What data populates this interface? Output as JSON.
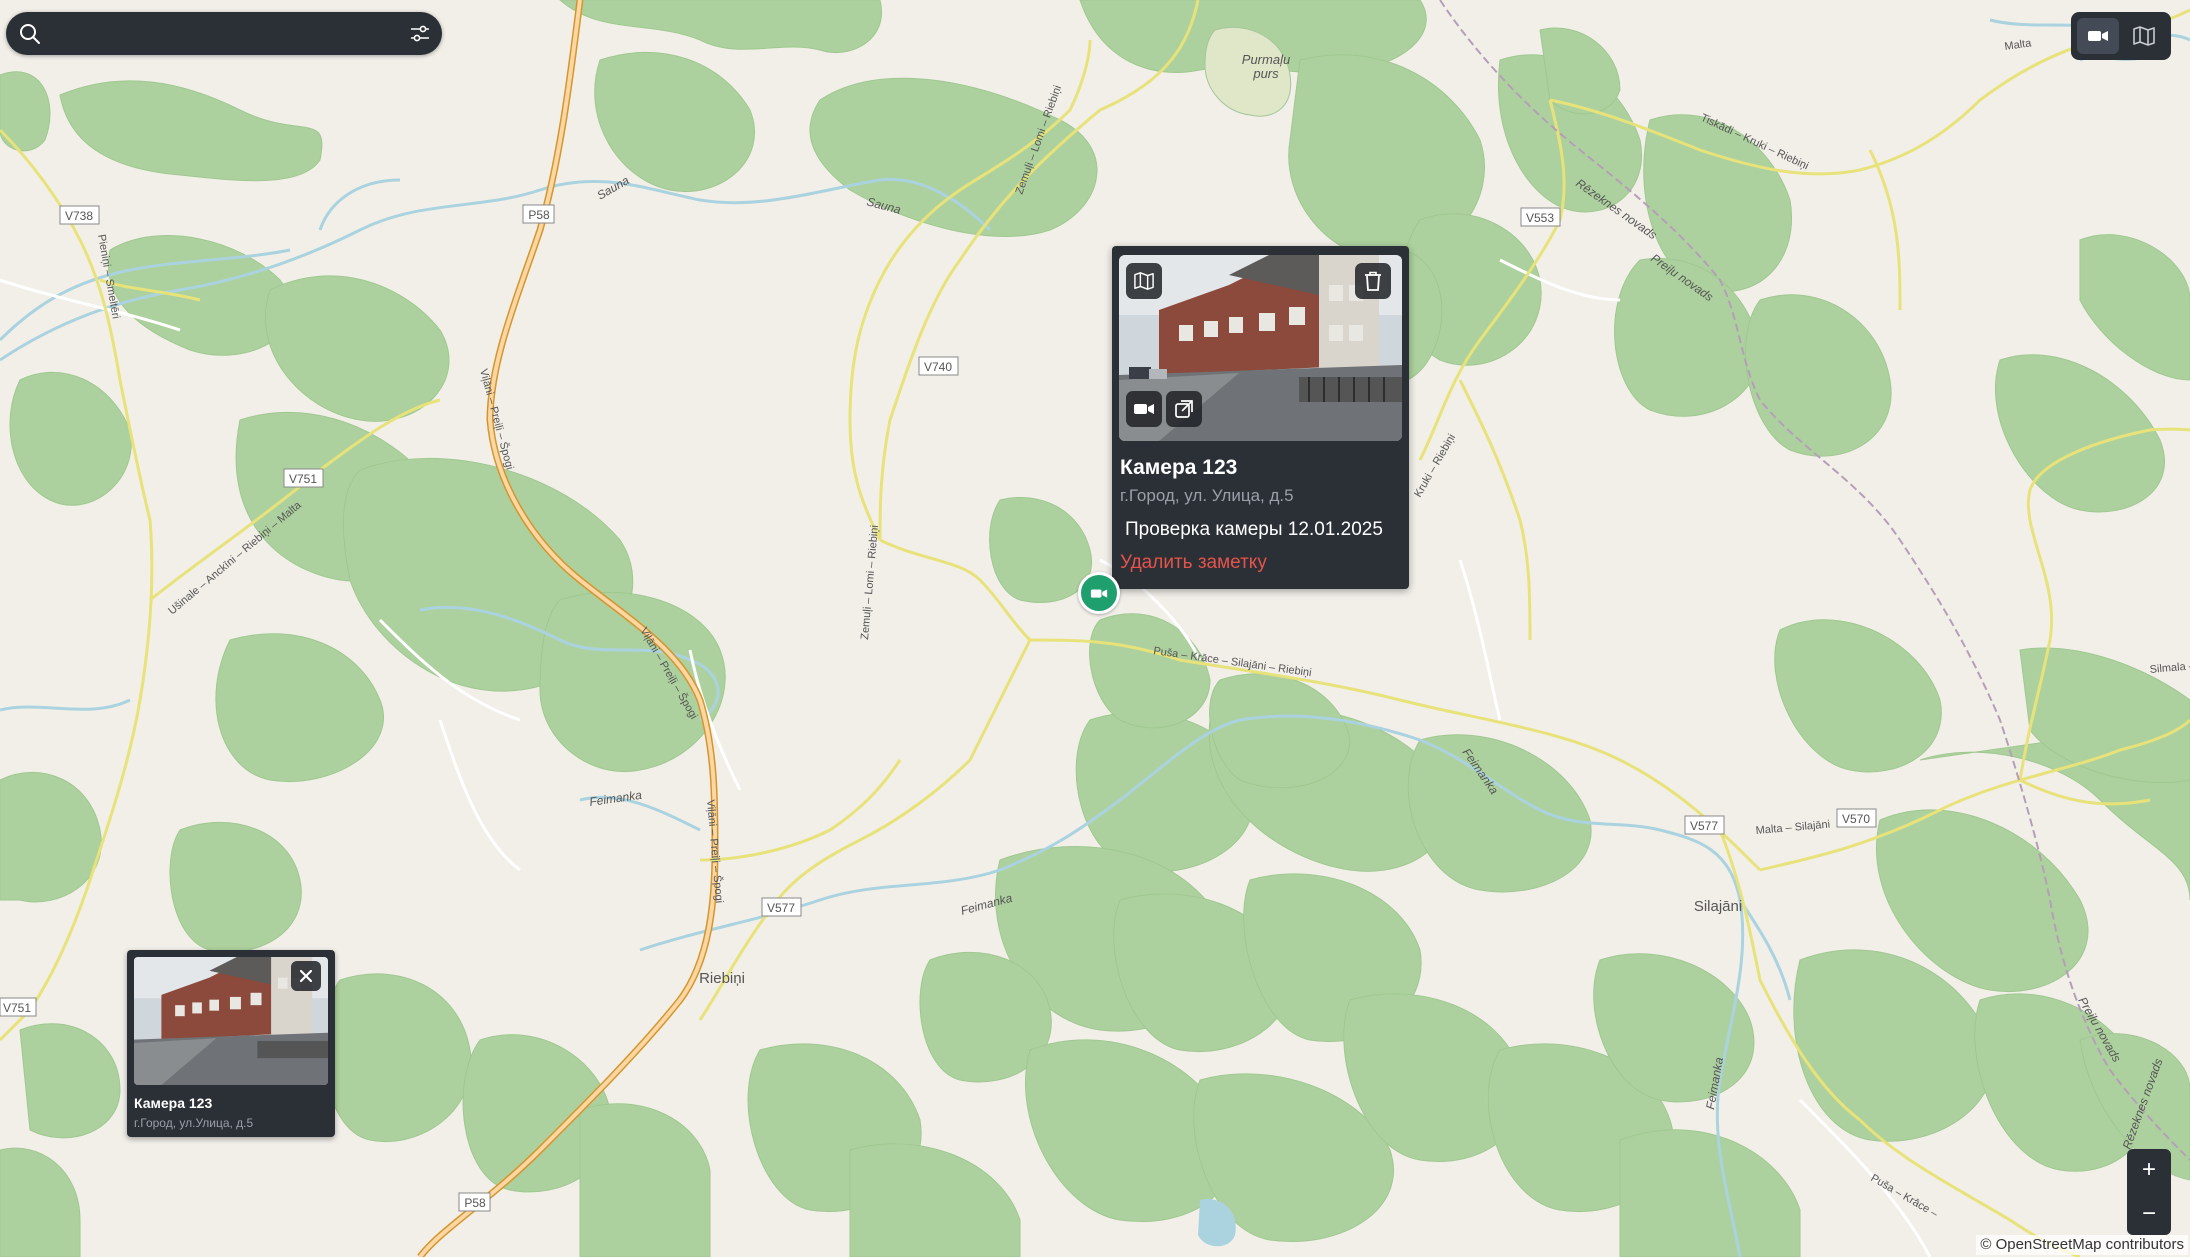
{
  "search": {
    "placeholder": ""
  },
  "layer_switch": {
    "active": "camera",
    "items": [
      "camera-icon",
      "map-icon"
    ]
  },
  "popup": {
    "title": "Камера 123",
    "address": "г.Город, ул. Улица, д.5",
    "note": "Проверка камеры 12.01.2025",
    "delete_note": "Удалить заметку"
  },
  "preview_card": {
    "title": "Камера 123",
    "address": "г.Город, ул.Улица, д.5"
  },
  "zoom": {
    "in": "+",
    "out": "−"
  },
  "attribution": "© OpenStreetMap contributors",
  "map_labels": {
    "purmalu": "Purmaļu",
    "purs": "purs",
    "sauna1": "Sauna",
    "sauna2": "Sauna",
    "v738": "V738",
    "p58_top": "P58",
    "v740": "V740",
    "v751_a": "V751",
    "v751_b": "V751",
    "v553": "V553",
    "v577_a": "V577",
    "v577_b": "V577",
    "v570": "V570",
    "p58_bottom": "P58",
    "riebini": "Riebiņi",
    "silajani": "Silajāni",
    "feimanka1": "Feimanka",
    "feimanka2": "Feimanka",
    "feimanka3": "Feimanka",
    "feimanka4": "Feimanka",
    "road_pusa": "Puša – Krāce – Silajāni – Riebiņi",
    "road_malta": "Malta – Silajāni",
    "road_tiskadi": "Tiskādi – Kruki – Riebiņi",
    "road_vilani1": "Viļāni – Preiļi – Špogi",
    "road_vilani2": "Viļāni – Preiļi – Špogi",
    "road_vilani3": "Viļāni – Preiļi – Špogi",
    "road_zemuli1": "Zemuļi – Lomi – Riebiņi",
    "road_zemuli2": "Zemuļi – Lomi – Riebiņi",
    "road_kruki": "Kruki – Riebiņi",
    "road_pusa2": "Puša – Krāce –",
    "road_silmala": "Silmala –",
    "road_malta_top": "Malta",
    "road_ruk": "ruk",
    "road_usinale": "Ušinale – Anckīni – Riebiņi – Malta",
    "road_pienini": "Pieniņi – Smeltēri",
    "rezeknes1": "Rēzeknes novads",
    "rezeknes2": "Rēzeknes novads",
    "preilu1": "Preiļu novads",
    "preilu2": "Preiļu novads",
    "rezeknes3": "Rēzeknes novads"
  }
}
